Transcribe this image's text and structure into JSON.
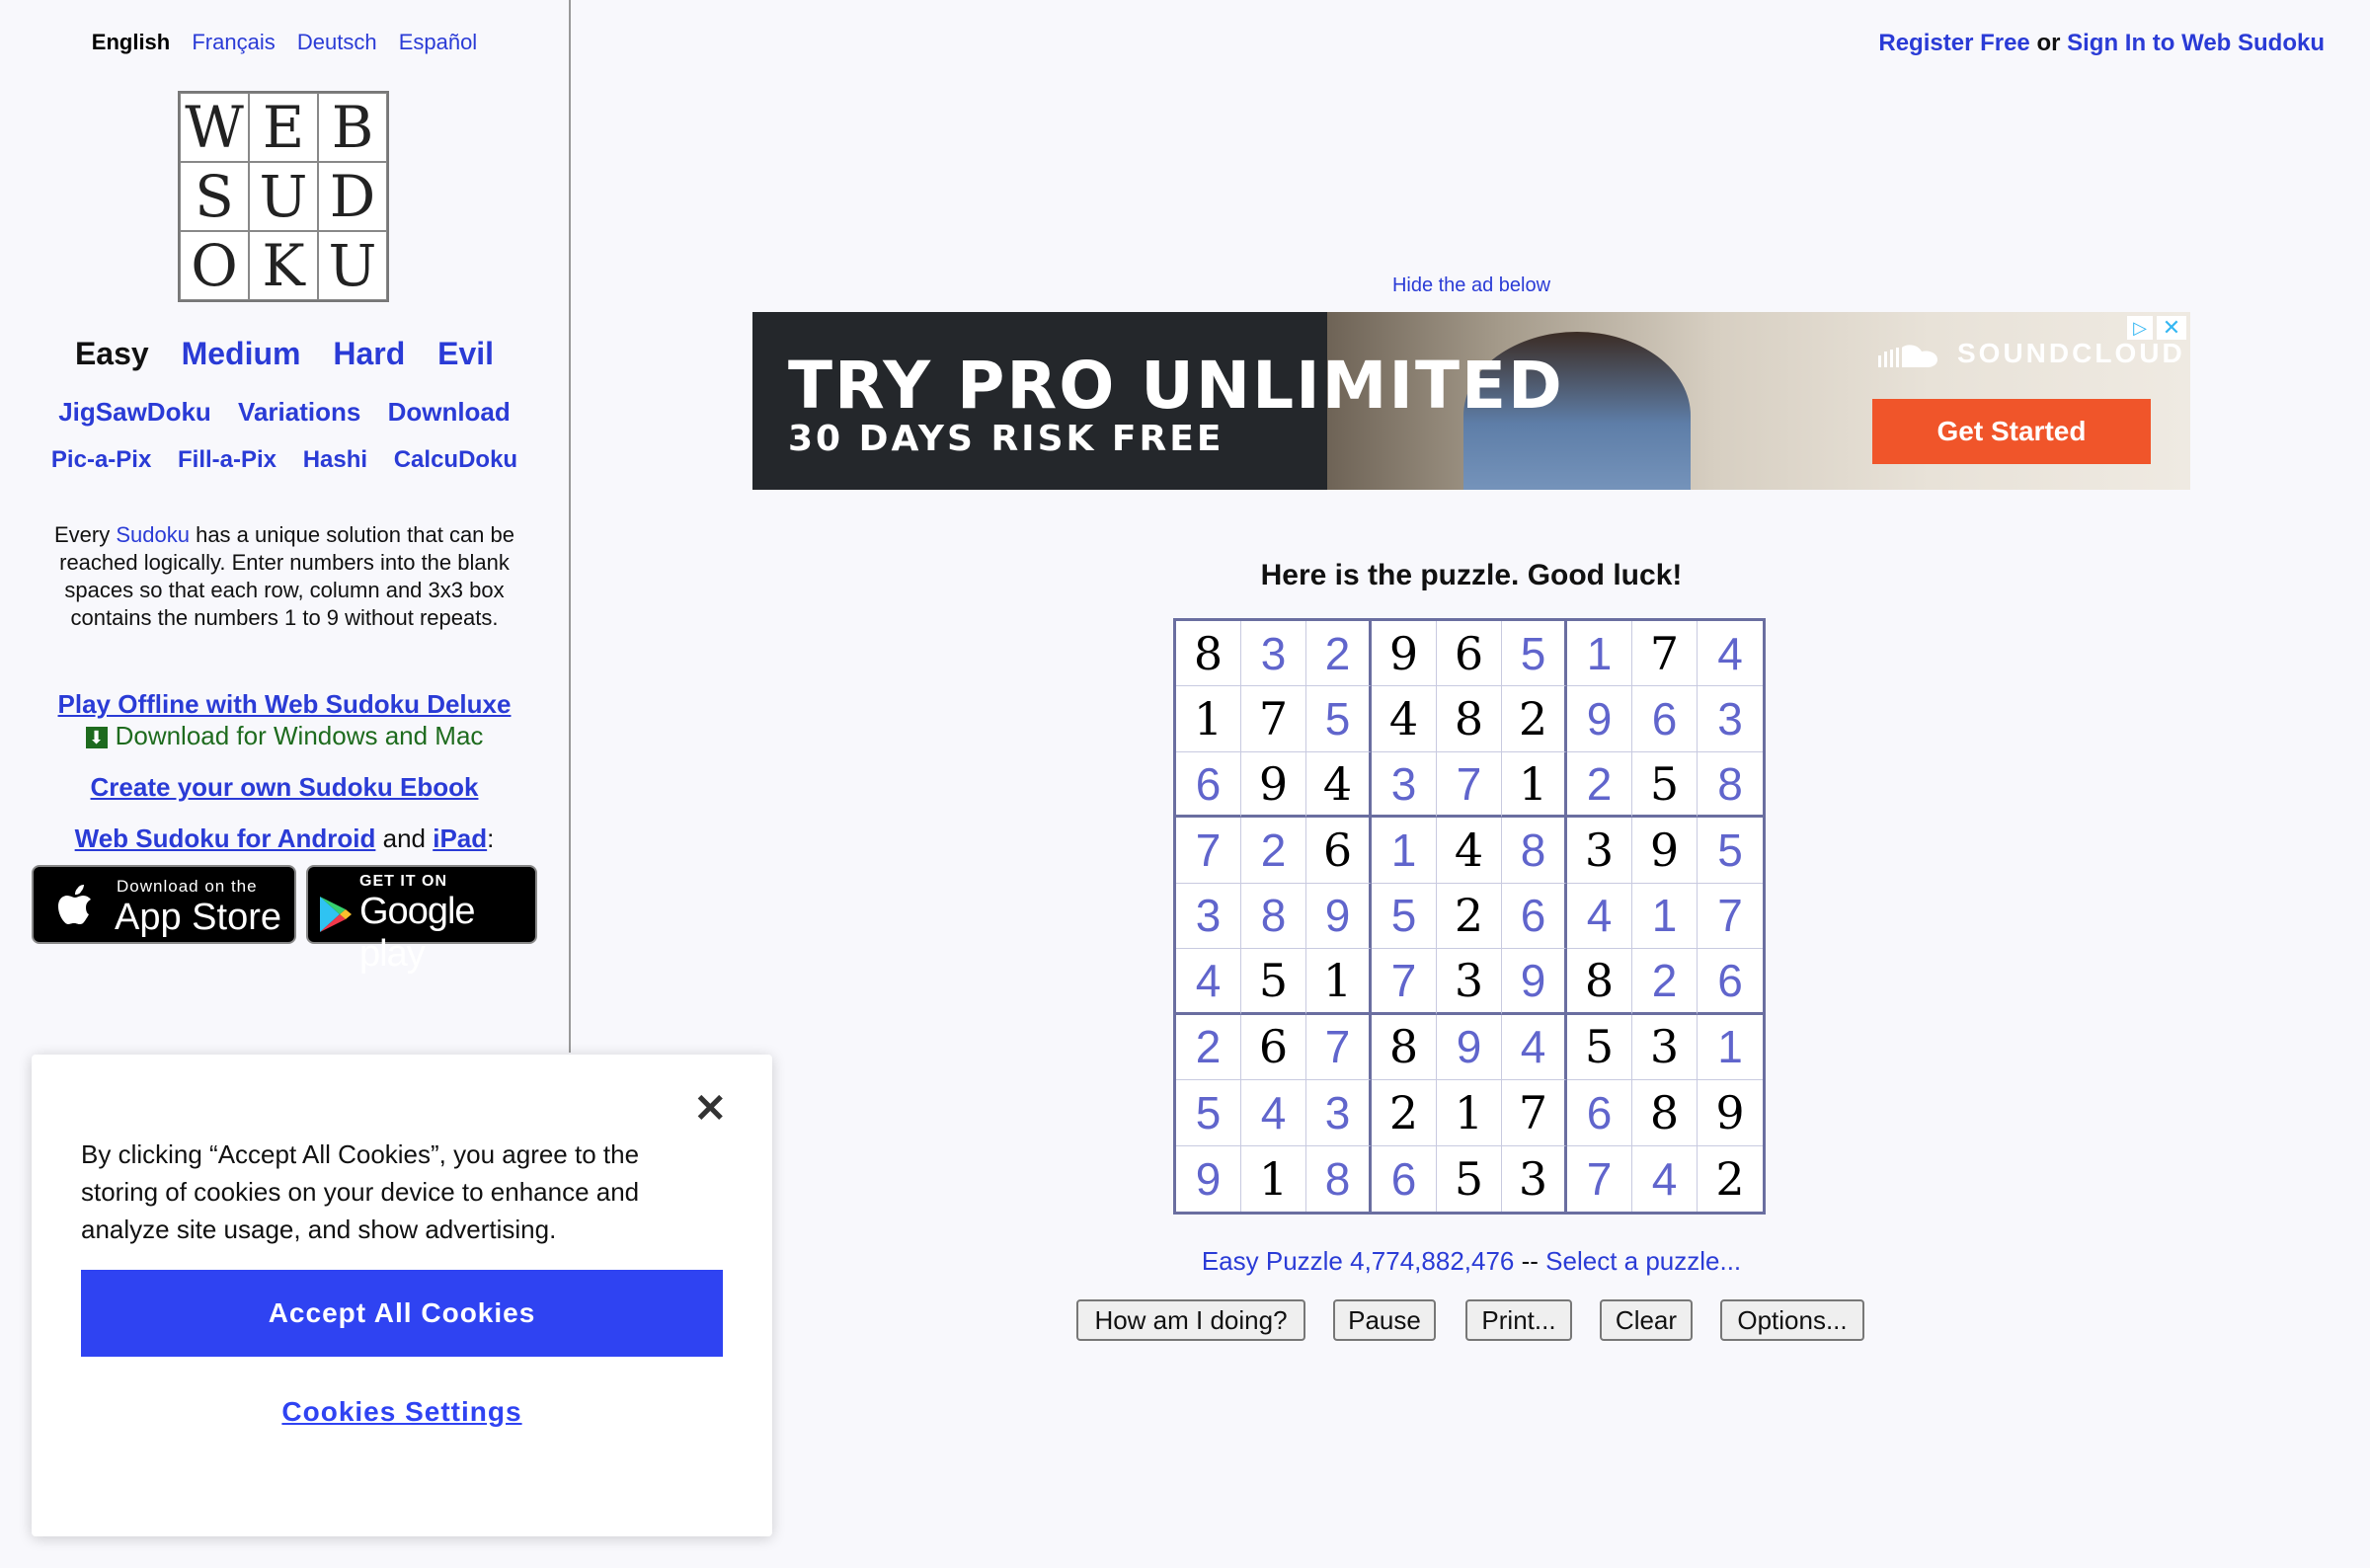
{
  "languages": {
    "english": "English",
    "french": "Français",
    "german": "Deutsch",
    "spanish": "Español"
  },
  "logo": {
    "letters": [
      "W",
      "E",
      "B",
      "S",
      "U",
      "D",
      "O",
      "K",
      "U"
    ]
  },
  "nav": {
    "difficulty": {
      "easy": "Easy",
      "medium": "Medium",
      "hard": "Hard",
      "evil": "Evil"
    },
    "row2": {
      "jigsaw": "JigSawDoku",
      "variations": "Variations",
      "download": "Download"
    },
    "row3": {
      "picapix": "Pic-a-Pix",
      "fillapix": "Fill-a-Pix",
      "hashi": "Hashi",
      "calcudoku": "CalcuDoku"
    }
  },
  "intro": {
    "prefix": "Every ",
    "link": "Sudoku",
    "suffix": " has a unique solution that can be reached logically. Enter numbers into the blank spaces so that each row, column and 3x3 box contains the numbers 1 to 9 without repeats."
  },
  "promos": {
    "offline": "Play Offline with Web Sudoku Deluxe",
    "download_win_mac": "Download for Windows and Mac",
    "ebook": "Create your own Sudoku Ebook",
    "android": "Web Sudoku for Android",
    "and": " and ",
    "ipad": "iPad",
    "colon": ":"
  },
  "stores": {
    "appstore_small": "Download on the",
    "appstore_big": "App Store",
    "gplay_small": "GET IT ON",
    "gplay_big": "Google play"
  },
  "header": {
    "register": "Register Free",
    "or": " or ",
    "signin": "Sign In to Web Sudoku"
  },
  "ad": {
    "hide_label": "Hide the ad below",
    "headline": "TRY PRO UNLIMITED",
    "subline": "30 DAYS RISK FREE",
    "brand": "SOUNDCLOUD",
    "cta": "Get Started",
    "brand_color": "#f0552a"
  },
  "puzzle": {
    "title": "Here is the puzzle. Good luck!",
    "grid": [
      [
        8,
        3,
        2,
        9,
        6,
        5,
        1,
        7,
        4
      ],
      [
        1,
        7,
        5,
        4,
        8,
        2,
        9,
        6,
        3
      ],
      [
        6,
        9,
        4,
        3,
        7,
        1,
        2,
        5,
        8
      ],
      [
        7,
        2,
        6,
        1,
        4,
        8,
        3,
        9,
        5
      ],
      [
        3,
        8,
        9,
        5,
        2,
        6,
        4,
        1,
        7
      ],
      [
        4,
        5,
        1,
        7,
        3,
        9,
        8,
        2,
        6
      ],
      [
        2,
        6,
        7,
        8,
        9,
        4,
        5,
        3,
        1
      ],
      [
        5,
        4,
        3,
        2,
        1,
        7,
        6,
        8,
        9
      ],
      [
        9,
        1,
        8,
        6,
        5,
        3,
        7,
        4,
        2
      ]
    ],
    "given": [
      [
        1,
        0,
        0,
        1,
        1,
        0,
        0,
        1,
        0
      ],
      [
        1,
        1,
        0,
        1,
        1,
        1,
        0,
        0,
        0
      ],
      [
        0,
        1,
        1,
        0,
        0,
        1,
        0,
        1,
        0
      ],
      [
        0,
        0,
        1,
        0,
        1,
        0,
        1,
        1,
        0
      ],
      [
        0,
        0,
        0,
        0,
        1,
        0,
        0,
        0,
        0
      ],
      [
        0,
        1,
        1,
        0,
        1,
        0,
        1,
        0,
        0
      ],
      [
        0,
        1,
        0,
        1,
        0,
        0,
        1,
        1,
        0
      ],
      [
        0,
        0,
        0,
        1,
        1,
        1,
        0,
        1,
        1
      ],
      [
        0,
        1,
        0,
        0,
        1,
        1,
        0,
        0,
        1
      ]
    ],
    "info_label": "Easy Puzzle 4,774,882,476",
    "info_sep": " -- ",
    "info_select": "Select a puzzle...",
    "given_color": "#000000",
    "entered_color": "#6065cc"
  },
  "buttons": {
    "how": "How am I doing?",
    "pause": "Pause",
    "print": "Print...",
    "clear": "Clear",
    "options": "Options..."
  },
  "cookie": {
    "text": "By clicking “Accept All Cookies”, you agree to the storing of cookies on your device to enhance and analyze site usage, and show advertising.",
    "accept": "Accept All Cookies",
    "settings": "Cookies Settings",
    "close_icon": "close-icon",
    "accent": "#2f43f2"
  }
}
